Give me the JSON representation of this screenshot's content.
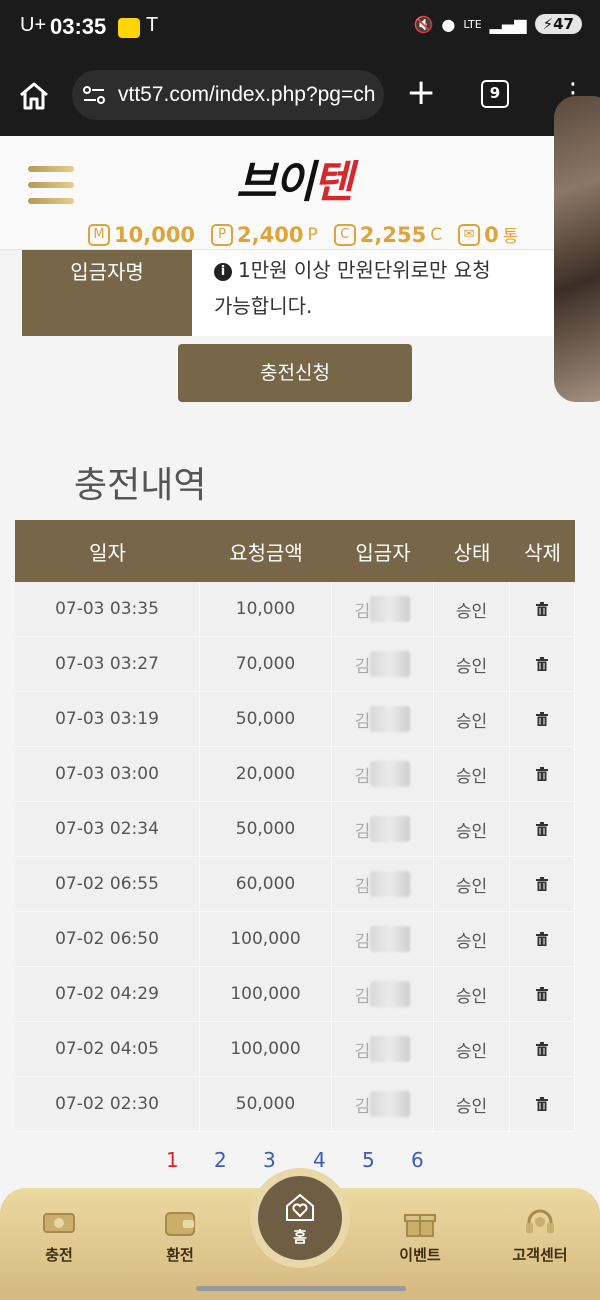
{
  "status": {
    "carrier": "U+",
    "time": "03:35",
    "t_icon": "T",
    "lte": "LTE",
    "battery": "47"
  },
  "browser": {
    "url": "vtt57.com/index.php?pg=ch",
    "tab_count": "9"
  },
  "site": {
    "logo_a": "브이",
    "logo_b": "텐",
    "balances": [
      {
        "icon": "M",
        "value": "10,000",
        "unit": ""
      },
      {
        "icon": "P",
        "value": "2,400",
        "unit": "P"
      },
      {
        "icon": "C",
        "value": "2,255",
        "unit": "C"
      },
      {
        "icon": "✉",
        "value": "0",
        "unit": "통"
      }
    ]
  },
  "deposit": {
    "label": "입금자명",
    "note_line1": "1만원 이상 만원단위로만 요청",
    "note_line2": "가능합니다."
  },
  "charge_button": "충전신청",
  "history": {
    "title": "충전내역",
    "headers": [
      "일자",
      "요청금액",
      "입금자",
      "상태",
      "삭제"
    ],
    "rows": [
      {
        "date": "07-03 03:35",
        "amount": "10,000",
        "depositor": "김",
        "status": "승인"
      },
      {
        "date": "07-03 03:27",
        "amount": "70,000",
        "depositor": "김",
        "status": "승인"
      },
      {
        "date": "07-03 03:19",
        "amount": "50,000",
        "depositor": "김",
        "status": "승인"
      },
      {
        "date": "07-03 03:00",
        "amount": "20,000",
        "depositor": "김",
        "status": "승인"
      },
      {
        "date": "07-03 02:34",
        "amount": "50,000",
        "depositor": "김",
        "status": "승인"
      },
      {
        "date": "07-02 06:55",
        "amount": "60,000",
        "depositor": "김",
        "status": "승인"
      },
      {
        "date": "07-02 06:50",
        "amount": "100,000",
        "depositor": "김",
        "status": "승인"
      },
      {
        "date": "07-02 04:29",
        "amount": "100,000",
        "depositor": "김",
        "status": "승인"
      },
      {
        "date": "07-02 04:05",
        "amount": "100,000",
        "depositor": "김",
        "status": "승인"
      },
      {
        "date": "07-02 02:30",
        "amount": "50,000",
        "depositor": "김",
        "status": "승인"
      }
    ]
  },
  "pagination": {
    "pages": [
      "1",
      "2",
      "3",
      "4",
      "5",
      "6"
    ],
    "current": "1",
    "current_color": "#d8262b"
  },
  "nav": {
    "charge": "충전",
    "exchange": "환전",
    "home": "홈",
    "event": "이벤트",
    "support": "고객센터"
  }
}
